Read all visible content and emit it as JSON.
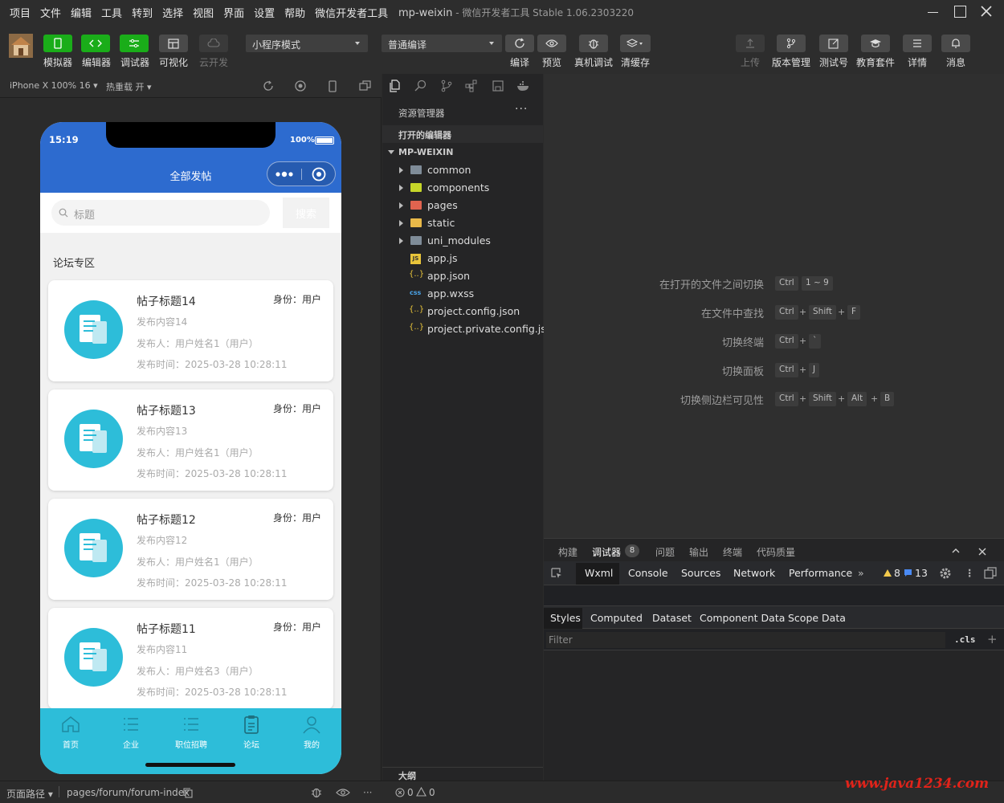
{
  "menubar": {
    "items": [
      "项目",
      "文件",
      "编辑",
      "工具",
      "转到",
      "选择",
      "视图",
      "界面",
      "设置",
      "帮助",
      "微信开发者工具"
    ],
    "app_name": "mp-weixin",
    "app_suffix": " - 微信开发者工具 Stable 1.06.2303220"
  },
  "toolbar": {
    "left_labels": [
      "模拟器",
      "编辑器",
      "调试器",
      "可视化",
      "云开发"
    ],
    "mode_select": "小程序模式",
    "compile_select": "普通编译",
    "mid_labels": [
      "编译",
      "预览",
      "真机调试",
      "清缓存"
    ],
    "right_labels": [
      "上传",
      "版本管理",
      "测试号",
      "教育套件",
      "详情",
      "消息"
    ]
  },
  "simulator": {
    "device": "iPhone X 100% 16",
    "hotreload": "热重载 开"
  },
  "phone": {
    "time": "15:19",
    "battery": "100%",
    "page_title": "全部发帖",
    "search_placeholder": "标题",
    "search_button": "搜索",
    "section_title": "论坛专区",
    "posts": [
      {
        "title": "帖子标题14",
        "role": "身份：用户",
        "content": "发布内容14",
        "author": "发布人：用户姓名1（用户）",
        "time": "发布时间：2025-03-28 10:28:11"
      },
      {
        "title": "帖子标题13",
        "role": "身份：用户",
        "content": "发布内容13",
        "author": "发布人：用户姓名1（用户）",
        "time": "发布时间：2025-03-28 10:28:11"
      },
      {
        "title": "帖子标题12",
        "role": "身份：用户",
        "content": "发布内容12",
        "author": "发布人：用户姓名1（用户）",
        "time": "发布时间：2025-03-28 10:28:11"
      },
      {
        "title": "帖子标题11",
        "role": "身份：用户",
        "content": "发布内容11",
        "author": "发布人：用户姓名3（用户）",
        "time": "发布时间：2025-03-28 10:28:11"
      }
    ],
    "tabs": [
      "首页",
      "企业",
      "职位招聘",
      "论坛",
      "我的"
    ]
  },
  "explorer": {
    "title": "资源管理器",
    "open_editors": "打开的编辑器",
    "project": "MP-WEIXIN",
    "folders": [
      "common",
      "components",
      "pages",
      "static",
      "uni_modules"
    ],
    "files": [
      {
        "name": "app.js",
        "badge": "JS"
      },
      {
        "name": "app.json",
        "badge": "{..}"
      },
      {
        "name": "app.wxss",
        "badge": "css"
      },
      {
        "name": "project.config.json",
        "badge": "{..}"
      },
      {
        "name": "project.private.config.js...",
        "badge": "{..}"
      }
    ],
    "outline": "大纲"
  },
  "editor": {
    "hints": [
      {
        "label": "在打开的文件之间切换",
        "keys": [
          "Ctrl",
          "1 ~ 9"
        ]
      },
      {
        "label": "在文件中查找",
        "keys": [
          "Ctrl",
          "Shift",
          "F"
        ]
      },
      {
        "label": "切换终端",
        "keys": [
          "Ctrl",
          "`"
        ]
      },
      {
        "label": "切换面板",
        "keys": [
          "Ctrl",
          "J"
        ]
      },
      {
        "label": "切换侧边栏可见性",
        "keys": [
          "Ctrl",
          "Shift",
          "Alt",
          "B"
        ]
      }
    ]
  },
  "panel": {
    "tabs": [
      "构建",
      "调试器",
      "问题",
      "输出",
      "终端",
      "代码质量"
    ],
    "debugger_badge": "8",
    "devtools_tabs": [
      "Wxml",
      "Console",
      "Sources",
      "Network",
      "Performance"
    ],
    "warnings": "8",
    "messages": "13",
    "style_tabs": [
      "Styles",
      "Computed",
      "Dataset",
      "Component Data",
      "Scope Data"
    ],
    "filter_placeholder": "Filter",
    "cls": ".cls"
  },
  "statusbar": {
    "page_path_label": "页面路径",
    "page_path": "pages/forum/forum-index",
    "errors": "0",
    "warnings": "0"
  },
  "watermark": "www.java1234.com",
  "colors": {
    "accent_green": "#1aad19",
    "nav_blue": "#2d6bcf",
    "tab_cyan": "#2dbdd9"
  }
}
